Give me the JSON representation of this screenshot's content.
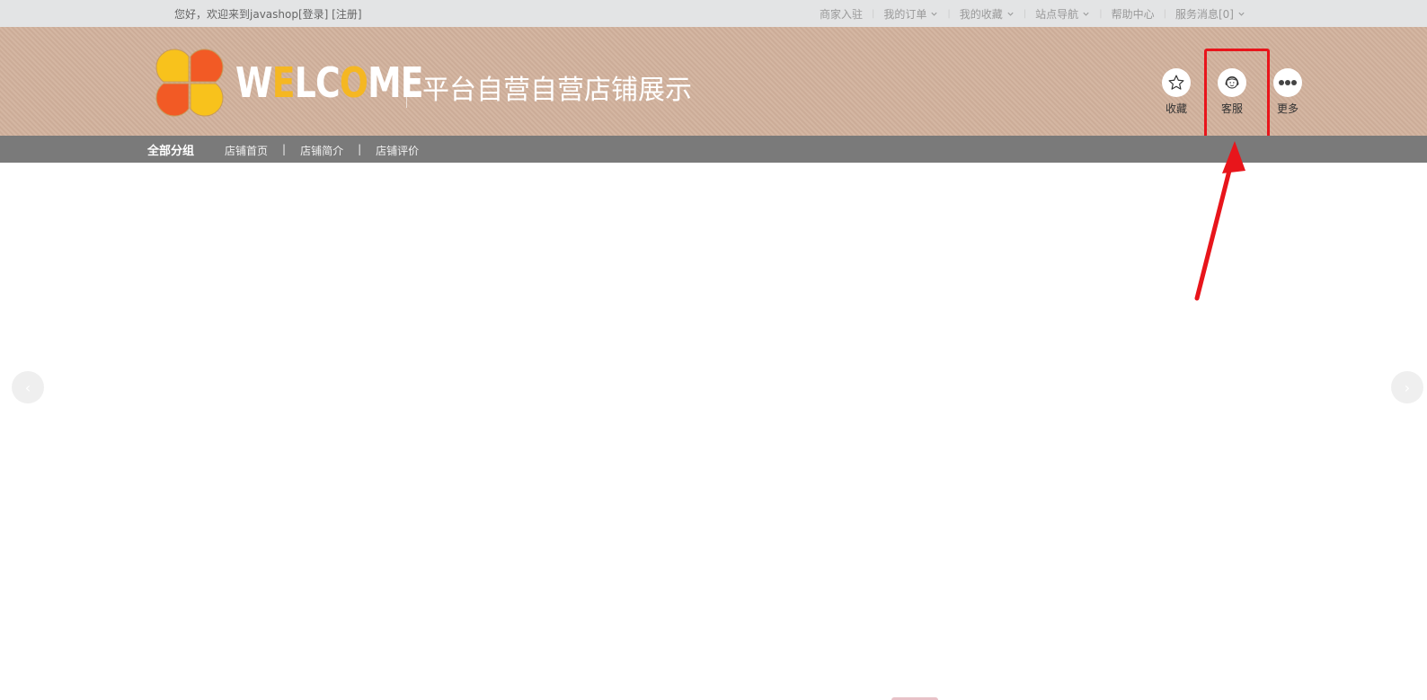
{
  "topbar": {
    "greeting": "您好，欢迎来到javashop",
    "login": "[登录]",
    "register": "[注册]",
    "nav": [
      {
        "label": "商家入驻",
        "dropdown": false
      },
      {
        "label": "我的订单",
        "dropdown": true
      },
      {
        "label": "我的收藏",
        "dropdown": true
      },
      {
        "label": "站点导航",
        "dropdown": true
      },
      {
        "label": "帮助中心",
        "dropdown": false
      },
      {
        "label": "服务消息[0]",
        "dropdown": true
      }
    ],
    "separator": "|"
  },
  "header": {
    "logo_text": {
      "part1": "W",
      "part2": "E",
      "part3": "LC",
      "part4": "O",
      "part5": "ME"
    },
    "store_name": "平台自营自营店铺展示",
    "buttons": {
      "favorite": "收藏",
      "customer_service": "客服",
      "more": "更多"
    },
    "icons": {
      "favorite": "star-icon",
      "customer_service": "headset-agent-icon",
      "more": "more-dots-icon"
    }
  },
  "catbar": {
    "all_groups": "全部分组",
    "links": [
      "店铺首页",
      "店铺简介",
      "店铺评价"
    ],
    "separator": "|"
  },
  "slider": {
    "prev": "‹",
    "next": "›"
  },
  "colors": {
    "header_bg": "#d2b29d",
    "catbar_bg": "#7a7a7a",
    "highlight": "#e8151b",
    "logo_accent": "#f5b722"
  }
}
